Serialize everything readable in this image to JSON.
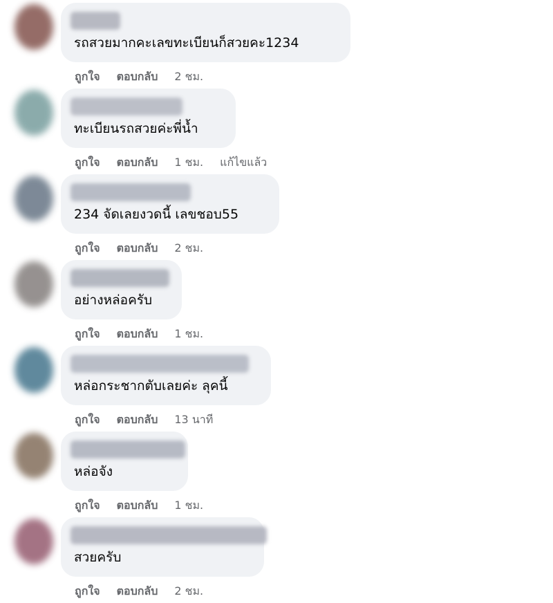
{
  "comments": [
    {
      "text": "รถสวยมากคะเลขทะเบียนก็สวยคะ1234",
      "like_label": "ถูกใจ",
      "reply_label": "ตอบกลับ",
      "time": "2 ชม.",
      "edited": "",
      "avatar_color": "#8a5d57",
      "name_blur_color": "#b7b9c2"
    },
    {
      "text": "ทะเบียนรถสวยค่ะพี่น้ำ",
      "like_label": "ถูกใจ",
      "reply_label": "ตอบกลับ",
      "time": "1 ชม.",
      "edited": "แก้ไขแล้ว",
      "avatar_color": "#7fa3a3",
      "name_blur_color": "#bcbfc8"
    },
    {
      "text": "234 จัดเลยงวดนี้ เลขชอบ55",
      "like_label": "ถูกใจ",
      "reply_label": "ตอบกลับ",
      "time": "2 ชม.",
      "edited": "",
      "avatar_color": "#6f7d8c",
      "name_blur_color": "#b8bcc6"
    },
    {
      "text": "อย่างหล่อครับ",
      "like_label": "ถูกใจ",
      "reply_label": "ตอบกลับ",
      "time": "1 ชม.",
      "edited": "",
      "avatar_color": "#8b8684",
      "name_blur_color": "#b4b8c1"
    },
    {
      "text": "หล่อกระชากตับเลยค่ะ ลุคนี้",
      "like_label": "ถูกใจ",
      "reply_label": "ตอบกลับ",
      "time": "13 นาที",
      "edited": "",
      "avatar_color": "#4f7d93",
      "name_blur_color": "#babec8"
    },
    {
      "text": "หล่อจัง",
      "like_label": "ถูกใจ",
      "reply_label": "ตอบกลับ",
      "time": "1 ชม.",
      "edited": "",
      "avatar_color": "#8a7664",
      "name_blur_color": "#b6bac4"
    },
    {
      "text": "สวยครับ",
      "like_label": "ถูกใจ",
      "reply_label": "ตอบกลับ",
      "time": "2 ชม.",
      "edited": "",
      "avatar_color": "#9b6477",
      "name_blur_color": "#b7b9c3"
    }
  ]
}
